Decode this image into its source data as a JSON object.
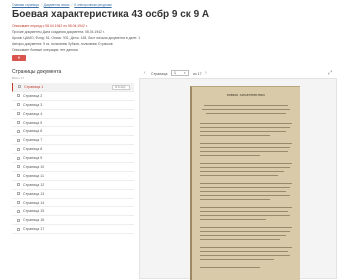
{
  "breadcrumb": [
    "Главная страница",
    "Документы эпохи",
    "К электронным ресурсам"
  ],
  "title": "Боевая характеристика 43 осбр 9 ск 9 А",
  "meta": {
    "dates": "Описывает период с 08.04.1942 по 08.04.1942 г.",
    "line1": "Прочие документы Дата создания документа: 08.04.1942 г.",
    "line2": "Архив: ЦАМО, Фонд: 51, Опись: 931, Дело: 148, Лист начала документа в деле: 1",
    "line3": "Авторы документа: 9 ск, полковник Зубков, полковник Страчков",
    "line4": "Описывает боевые операции: нет данных"
  },
  "red_button": "Ф",
  "left": {
    "heading": "Страницы документа",
    "subheading": "Всего 17",
    "go_button": "К 1 стр.",
    "pages": [
      "Страница 1",
      "Страница 2",
      "Страница 3",
      "Страница 4",
      "Страница 5",
      "Страница 6",
      "Страница 7",
      "Страница 8",
      "Страница 9",
      "Страница 10",
      "Страница 11",
      "Страница 12",
      "Страница 13",
      "Страница 14",
      "Страница 15",
      "Страница 16",
      "Страница 17"
    ]
  },
  "viewer": {
    "page_label": "Страница:",
    "page_value": "1",
    "page_total": "из 17",
    "doc_title": "БОЕВАЯ ХАРАКТЕРИСТИКА"
  }
}
